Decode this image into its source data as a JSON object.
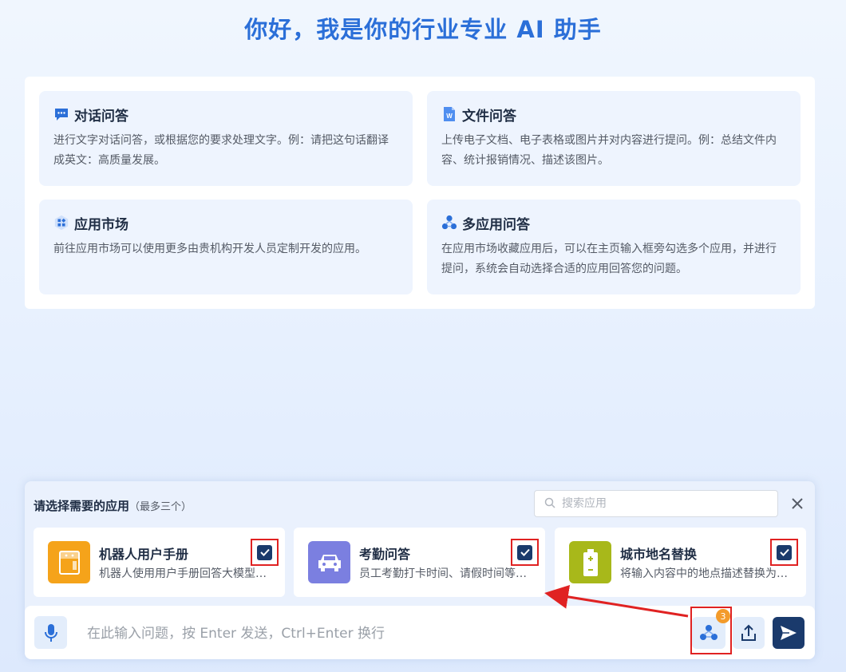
{
  "page_title": "你好，我是你的行业专业 AI 助手",
  "features": [
    {
      "icon": "chat-bubble-icon",
      "title": "对话问答",
      "desc": "进行文字对话问答，或根据您的要求处理文字。例：请把这句话翻译成英文：高质量发展。"
    },
    {
      "icon": "word-document-icon",
      "title": "文件问答",
      "desc": "上传电子文档、电子表格或图片并对内容进行提问。例：总结文件内容、统计报销情况、描述该图片。"
    },
    {
      "icon": "app-market-icon",
      "title": "应用市场",
      "desc": "前往应用市场可以使用更多由贵机构开发人员定制开发的应用。"
    },
    {
      "icon": "multi-app-icon",
      "title": "多应用问答",
      "desc": "在应用市场收藏应用后，可以在主页输入框旁勾选多个应用，并进行提问，系统会自动选择合适的应用回答您的问题。"
    }
  ],
  "picker": {
    "title": "请选择需要的应用",
    "subtitle": "（最多三个）",
    "search_placeholder": "搜索应用",
    "apps": [
      {
        "name": "机器人用户手册",
        "desc": "机器人使用用户手册回答大模型相关问题",
        "icon": "manual-book-icon",
        "color": "#f5a31a",
        "checked": true
      },
      {
        "name": "考勤问答",
        "desc": "员工考勤打卡时间、请假时间等问题",
        "icon": "car-icon",
        "color": "#7b7fe0",
        "checked": true
      },
      {
        "name": "城市地名替换",
        "desc": "将输入内容中的地点描述替换为标准地名",
        "icon": "battery-icon",
        "color": "#a8b81a",
        "checked": true
      }
    ]
  },
  "input": {
    "placeholder": "在此输入问题，按 Enter 发送，Ctrl+Enter 换行",
    "selected_count": "3"
  },
  "colors": {
    "accent": "#2b6fd8",
    "dark": "#1a3a6c",
    "highlight": "#e02222"
  }
}
